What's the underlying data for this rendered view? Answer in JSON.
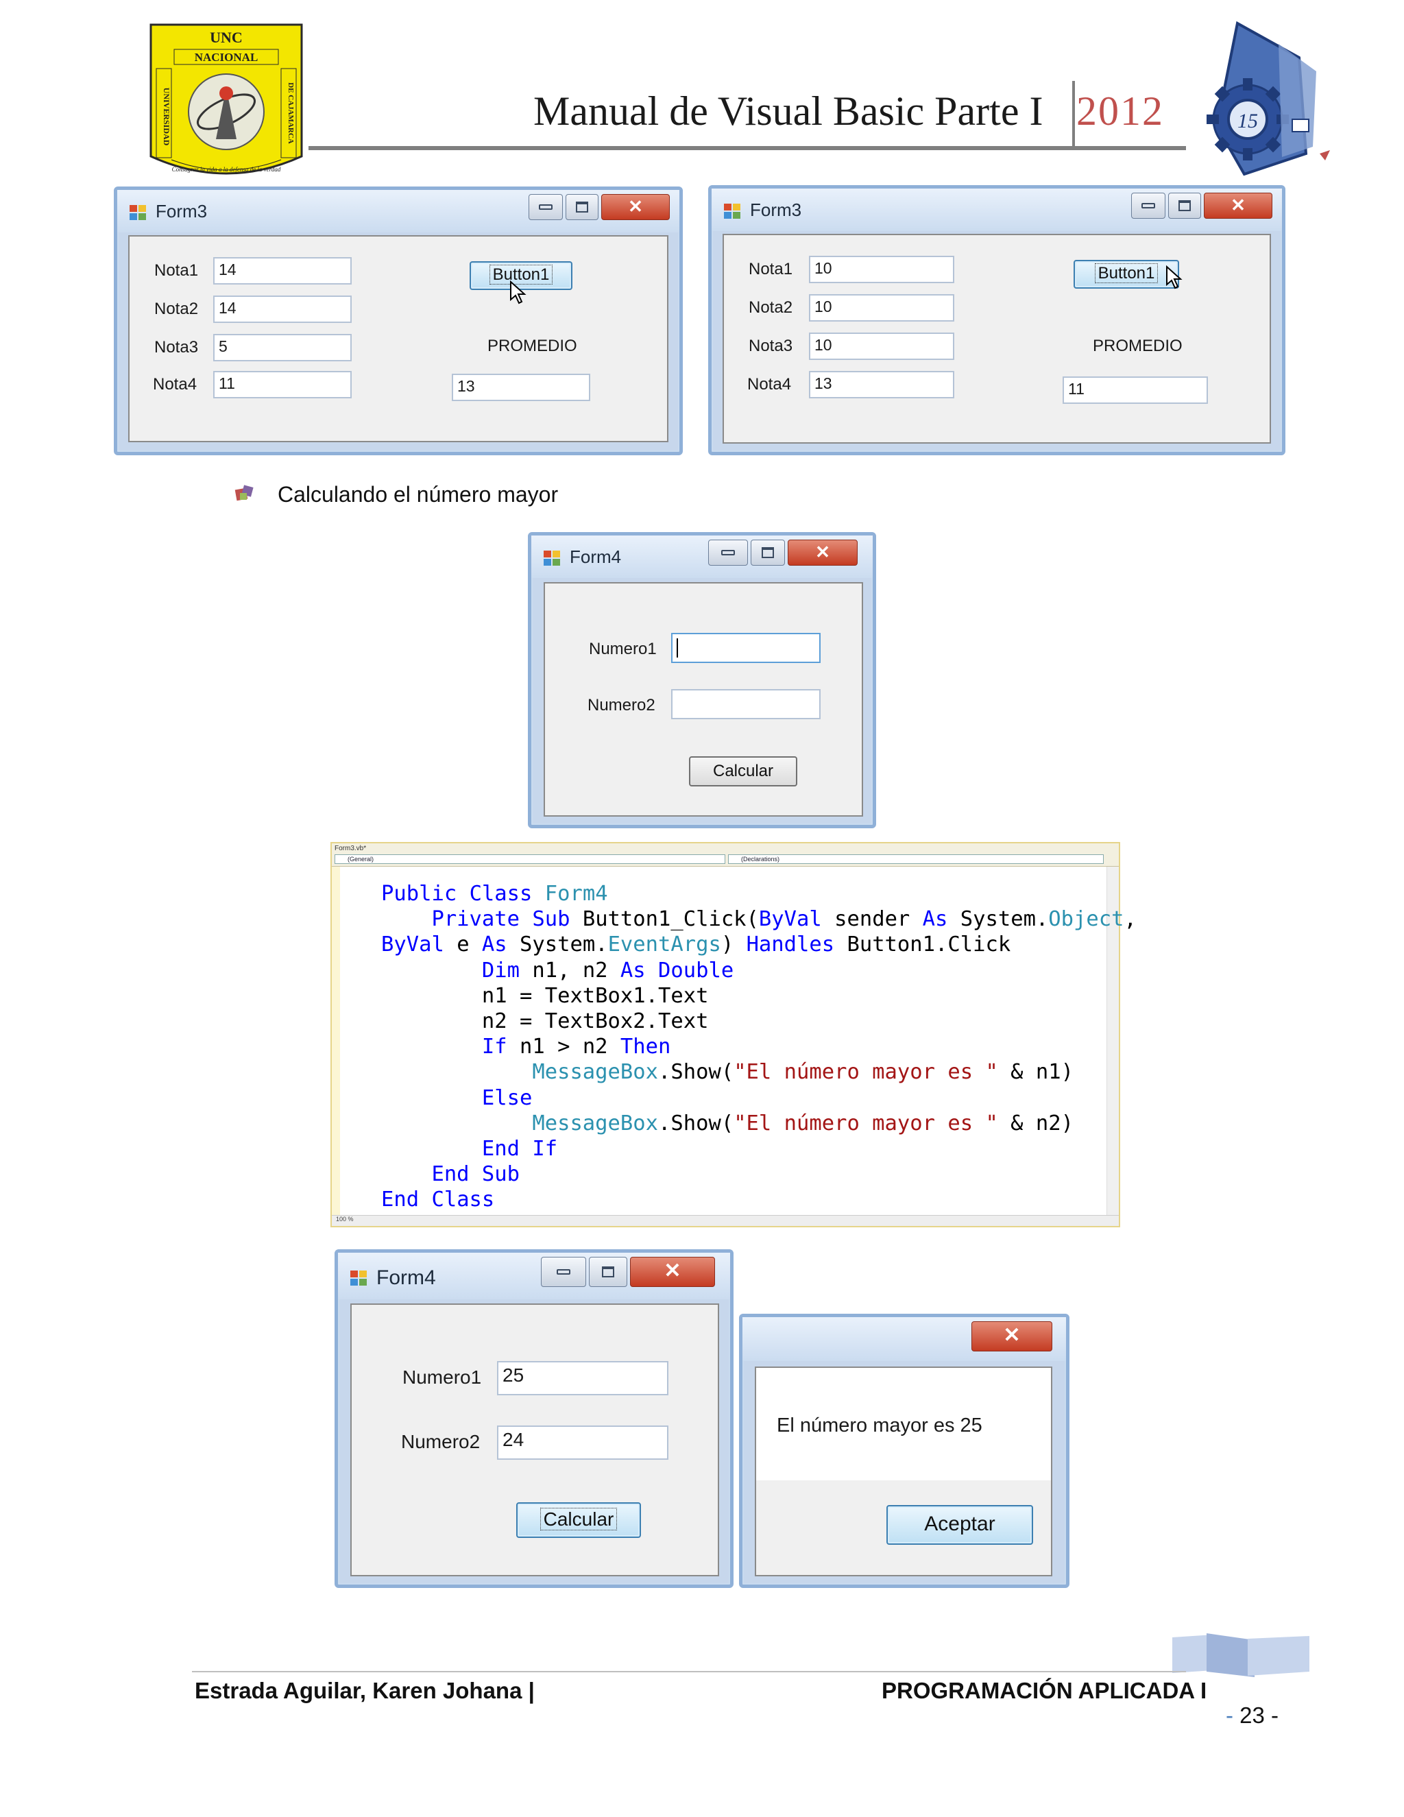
{
  "header": {
    "title": "Manual de Visual Basic Parte I",
    "year": "2012",
    "left_logo": {
      "name": "UNC Nacional de Cajamarca seal",
      "top_text": "UNC",
      "band": "NACIONAL",
      "side_left": "UNIVERSIDAD",
      "side_right": "DE CAJAMARCA",
      "motto": "Consagrar la vida a la defensa de la verdad"
    },
    "right_logo": {
      "name": "Programación y Sistemas gear emblem"
    }
  },
  "form3_a": {
    "title": "Form3",
    "labels": [
      "Nota1",
      "Nota2",
      "Nota3",
      "Nota4"
    ],
    "values": [
      "14",
      "14",
      "5",
      "11"
    ],
    "button": "Button1",
    "result_label": "PROMEDIO",
    "result_value": "13"
  },
  "form3_b": {
    "title": "Form3",
    "labels": [
      "Nota1",
      "Nota2",
      "Nota3",
      "Nota4"
    ],
    "values": [
      "10",
      "10",
      "10",
      "13"
    ],
    "button": "Button1",
    "result_label": "PROMEDIO",
    "result_value": "11"
  },
  "section": {
    "bullet_text": "Calculando el número mayor"
  },
  "form4_empty": {
    "title": "Form4",
    "labels": [
      "Numero1",
      "Numero2"
    ],
    "values": [
      "",
      ""
    ],
    "button": "Calcular"
  },
  "editor": {
    "tab": "Form3.vb*",
    "left_combo": "(General)",
    "right_combo": "(Declarations)",
    "zoom": "100 %",
    "code_lines": [
      "Public Class Form4",
      "    Private Sub Button1_Click(ByVal sender As System.Object,",
      "ByVal e As System.EventArgs) Handles Button1.Click",
      "        Dim n1, n2 As Double",
      "        n1 = TextBox1.Text",
      "        n2 = TextBox2.Text",
      "        If n1 > n2 Then",
      "            MessageBox.Show(\"El número mayor es \" & n1)",
      "        Else",
      "            MessageBox.Show(\"El número mayor es \" & n2)",
      "        End If",
      "    End Sub",
      "End Class"
    ]
  },
  "form4_filled": {
    "title": "Form4",
    "labels": [
      "Numero1",
      "Numero2"
    ],
    "values": [
      "25",
      "24"
    ],
    "button": "Calcular"
  },
  "message_box": {
    "message": "El número mayor es 25",
    "button": "Aceptar"
  },
  "footer": {
    "author": "Estrada Aguilar, Karen Johana |",
    "course": "PROGRAMACIÓN APLICADA I",
    "page_number": "23",
    "dash": "-"
  },
  "colors": {
    "year": "#c0504d",
    "keyword": "#0000ff",
    "type": "#2b91af",
    "string": "#a31515",
    "window_frame": "#8fb0d8"
  }
}
